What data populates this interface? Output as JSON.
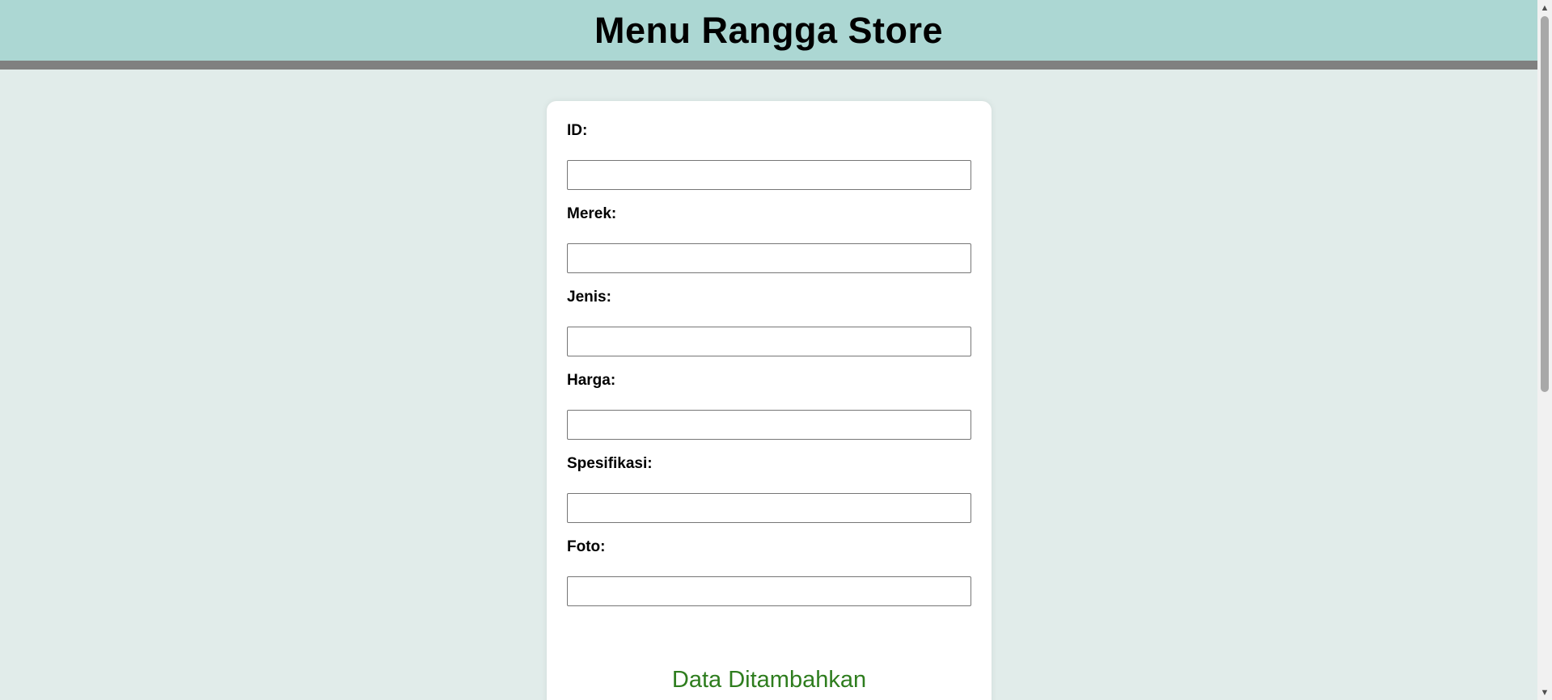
{
  "header": {
    "title": "Menu Rangga Store",
    "background": "#acd7d3",
    "bar_color": "#808080"
  },
  "form": {
    "fields": [
      {
        "label": "ID:",
        "value": ""
      },
      {
        "label": "Merek:",
        "value": ""
      },
      {
        "label": "Jenis:",
        "value": ""
      },
      {
        "label": "Harga:",
        "value": ""
      },
      {
        "label": "Spesifikasi:",
        "value": ""
      },
      {
        "label": "Foto:",
        "value": ""
      }
    ],
    "status_message": "Data Ditambahkan",
    "status_color": "#2e7d1e"
  },
  "scrollbar": {
    "up_icon": "triangle-up-icon",
    "down_icon": "triangle-down-icon"
  }
}
